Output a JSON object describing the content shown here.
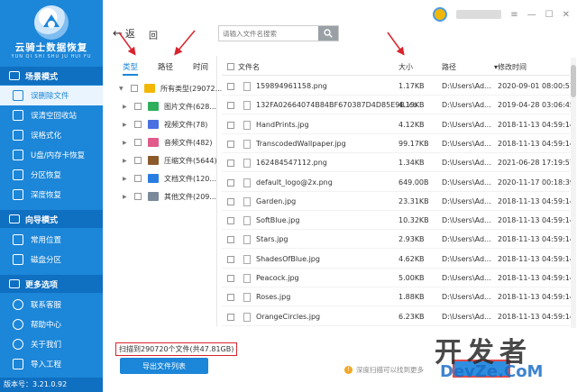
{
  "app": {
    "title": "云骑士数据恢复",
    "subtitle": "YUN QI SHI SHU JU HUI FU",
    "version": "版本号：3.21.0.92"
  },
  "sidebar": {
    "sections": [
      {
        "label": "场景模式",
        "items": [
          "误删除文件",
          "误清空回收站",
          "误格式化",
          "U盘/内存卡恢复",
          "分区恢复",
          "深度恢复"
        ]
      },
      {
        "label": "向导模式",
        "items": [
          "常用位置",
          "磁盘分区"
        ]
      },
      {
        "label": "更多选项",
        "items": [
          "联系客服",
          "帮助中心",
          "关于我们",
          "导入工程"
        ]
      }
    ]
  },
  "toolbar": {
    "back_label": "返",
    "up_label": "回",
    "search_placeholder": "请输入文件名搜索"
  },
  "tree": {
    "tabs": [
      "类型",
      "路径",
      "时间"
    ],
    "nodes": [
      {
        "label": "所有类型(29072...",
        "color": "#f2b705"
      },
      {
        "label": "图片文件(628...",
        "color": "#2fae5b"
      },
      {
        "label": "视频文件(78)",
        "color": "#4a6fe0"
      },
      {
        "label": "音频文件(482)",
        "color": "#e05a8a"
      },
      {
        "label": "压缩文件(5644)",
        "color": "#8a5a2b"
      },
      {
        "label": "文档文件(120...",
        "color": "#2a7de0"
      },
      {
        "label": "其他文件(209...",
        "color": "#7a8a9a"
      }
    ]
  },
  "table": {
    "columns": [
      "文件名",
      "大小",
      "路径",
      "修改时间"
    ],
    "rows": [
      {
        "name": "159894961158.png",
        "size": "1.17KB",
        "path": "D:\\Users\\Ad...",
        "time": "2020-09-01 08:00:51"
      },
      {
        "name": "132FA02664074B84BF670387D4D85E9B.ico",
        "size": "4.19KB",
        "path": "D:\\Users\\Ad...",
        "time": "2019-04-28 03:06:45"
      },
      {
        "name": "HandPrints.jpg",
        "size": "4.12KB",
        "path": "D:\\Users\\Ad...",
        "time": "2018-11-13 04:59:14"
      },
      {
        "name": "TranscodedWallpaper.jpg",
        "size": "99.17KB",
        "path": "D:\\Users\\Ad...",
        "time": "2018-11-13 04:59:14"
      },
      {
        "name": "162484547112.png",
        "size": "1.34KB",
        "path": "D:\\Users\\Ad...",
        "time": "2021-06-28 17:19:57"
      },
      {
        "name": "default_logo@2x.png",
        "size": "649.00B",
        "path": "D:\\Users\\Ad...",
        "time": "2020-11-17 00:18:39"
      },
      {
        "name": "Garden.jpg",
        "size": "23.31KB",
        "path": "D:\\Users\\Ad...",
        "time": "2018-11-13 04:59:14"
      },
      {
        "name": "SoftBlue.jpg",
        "size": "10.32KB",
        "path": "D:\\Users\\Ad...",
        "time": "2018-11-13 04:59:14"
      },
      {
        "name": "Stars.jpg",
        "size": "2.93KB",
        "path": "D:\\Users\\Ad...",
        "time": "2018-11-13 04:59:14"
      },
      {
        "name": "ShadesOfBlue.jpg",
        "size": "4.62KB",
        "path": "D:\\Users\\Ad...",
        "time": "2018-11-13 04:59:14"
      },
      {
        "name": "Peacock.jpg",
        "size": "5.00KB",
        "path": "D:\\Users\\Ad...",
        "time": "2018-11-13 04:59:14"
      },
      {
        "name": "Roses.jpg",
        "size": "1.88KB",
        "path": "D:\\Users\\Ad...",
        "time": "2018-11-13 04:59:14"
      },
      {
        "name": "OrangeCircles.jpg",
        "size": "6.23KB",
        "path": "D:\\Users\\Ad...",
        "time": "2018-11-13 04:59:14"
      }
    ]
  },
  "footer": {
    "scan_status": "扫描到290720个文件(共47.81GB)",
    "export_label": "导出文件列表",
    "deep_hint": "深度扫描可以找到更多"
  },
  "watermark": {
    "big": "开发者",
    "small": "DevZe.CoM"
  },
  "colors": {
    "sidebar": "#1c86d8",
    "sidebar_header": "#0f6fc1",
    "highlight": "#d9232d"
  }
}
